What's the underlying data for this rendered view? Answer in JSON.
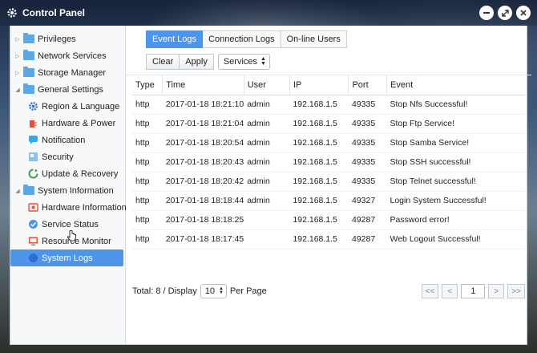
{
  "window": {
    "title": "Control Panel"
  },
  "sidebar": {
    "items": [
      {
        "label": "Privileges",
        "level": 0,
        "type": "folder"
      },
      {
        "label": "Network Services",
        "level": 0,
        "type": "folder"
      },
      {
        "label": "Storage Manager",
        "level": 0,
        "type": "folder"
      },
      {
        "label": "General Settings",
        "level": 0,
        "type": "folder",
        "expanded": true
      },
      {
        "label": "Region & Language",
        "level": 1,
        "icon": "gear-icon"
      },
      {
        "label": "Hardware & Power",
        "level": 1,
        "icon": "power-icon"
      },
      {
        "label": "Notification",
        "level": 1,
        "icon": "chat-icon"
      },
      {
        "label": "Security",
        "level": 1,
        "icon": "shield-icon"
      },
      {
        "label": "Update & Recovery",
        "level": 1,
        "icon": "refresh-icon"
      },
      {
        "label": "System Information",
        "level": 0,
        "type": "folder",
        "expanded": true
      },
      {
        "label": "Hardware Information",
        "level": 1,
        "icon": "hardware-icon"
      },
      {
        "label": "Service Status",
        "level": 1,
        "icon": "status-icon"
      },
      {
        "label": "Resource Monitor",
        "level": 1,
        "icon": "monitor-icon"
      },
      {
        "label": "System Logs",
        "level": 1,
        "icon": "logs-icon",
        "selected": true
      }
    ]
  },
  "tabs": [
    {
      "label": "Event Logs",
      "active": true
    },
    {
      "label": "Connection Logs",
      "active": false
    },
    {
      "label": "On-line Users",
      "active": false
    }
  ],
  "toolbar": {
    "clear_label": "Clear",
    "apply_label": "Apply",
    "filter_value": "Services"
  },
  "table": {
    "columns": [
      "Type",
      "Time",
      "User",
      "IP",
      "Port",
      "Event"
    ],
    "rows": [
      [
        "http",
        "2017-01-18 18:21:10",
        "admin",
        "192.168.1.5",
        "49335",
        "Stop Nfs Successful!"
      ],
      [
        "http",
        "2017-01-18 18:21:04",
        "admin",
        "192.168.1.5",
        "49335",
        "Stop Ftp Service!"
      ],
      [
        "http",
        "2017-01-18 18:20:54",
        "admin",
        "192.168.1.5",
        "49335",
        "Stop Samba Service!"
      ],
      [
        "http",
        "2017-01-18 18:20:43",
        "admin",
        "192.168.1.5",
        "49335",
        "Stop SSH successful!"
      ],
      [
        "http",
        "2017-01-18 18:20:42",
        "admin",
        "192.168.1.5",
        "49335",
        "Stop Telnet successful!"
      ],
      [
        "http",
        "2017-01-18 18:18:44",
        "admin",
        "192.168.1.5",
        "49327",
        "Login System Successful!"
      ],
      [
        "http",
        "2017-01-18 18:18:25",
        "",
        "192.168.1.5",
        "49287",
        "Password error!"
      ],
      [
        "http",
        "2017-01-18 18:17:45",
        "",
        "192.168.1.5",
        "49287",
        "Web Logout Successful!"
      ]
    ]
  },
  "footer": {
    "total_label": "Total: 8 / Display",
    "per_page_value": "10",
    "per_page_label": "Per Page",
    "pager": {
      "first": "<<",
      "prev": "<",
      "page": "1",
      "next": ">",
      "last": ">>"
    }
  },
  "colors": {
    "accent": "#4d94ea",
    "folder": "#5aa8e6"
  }
}
